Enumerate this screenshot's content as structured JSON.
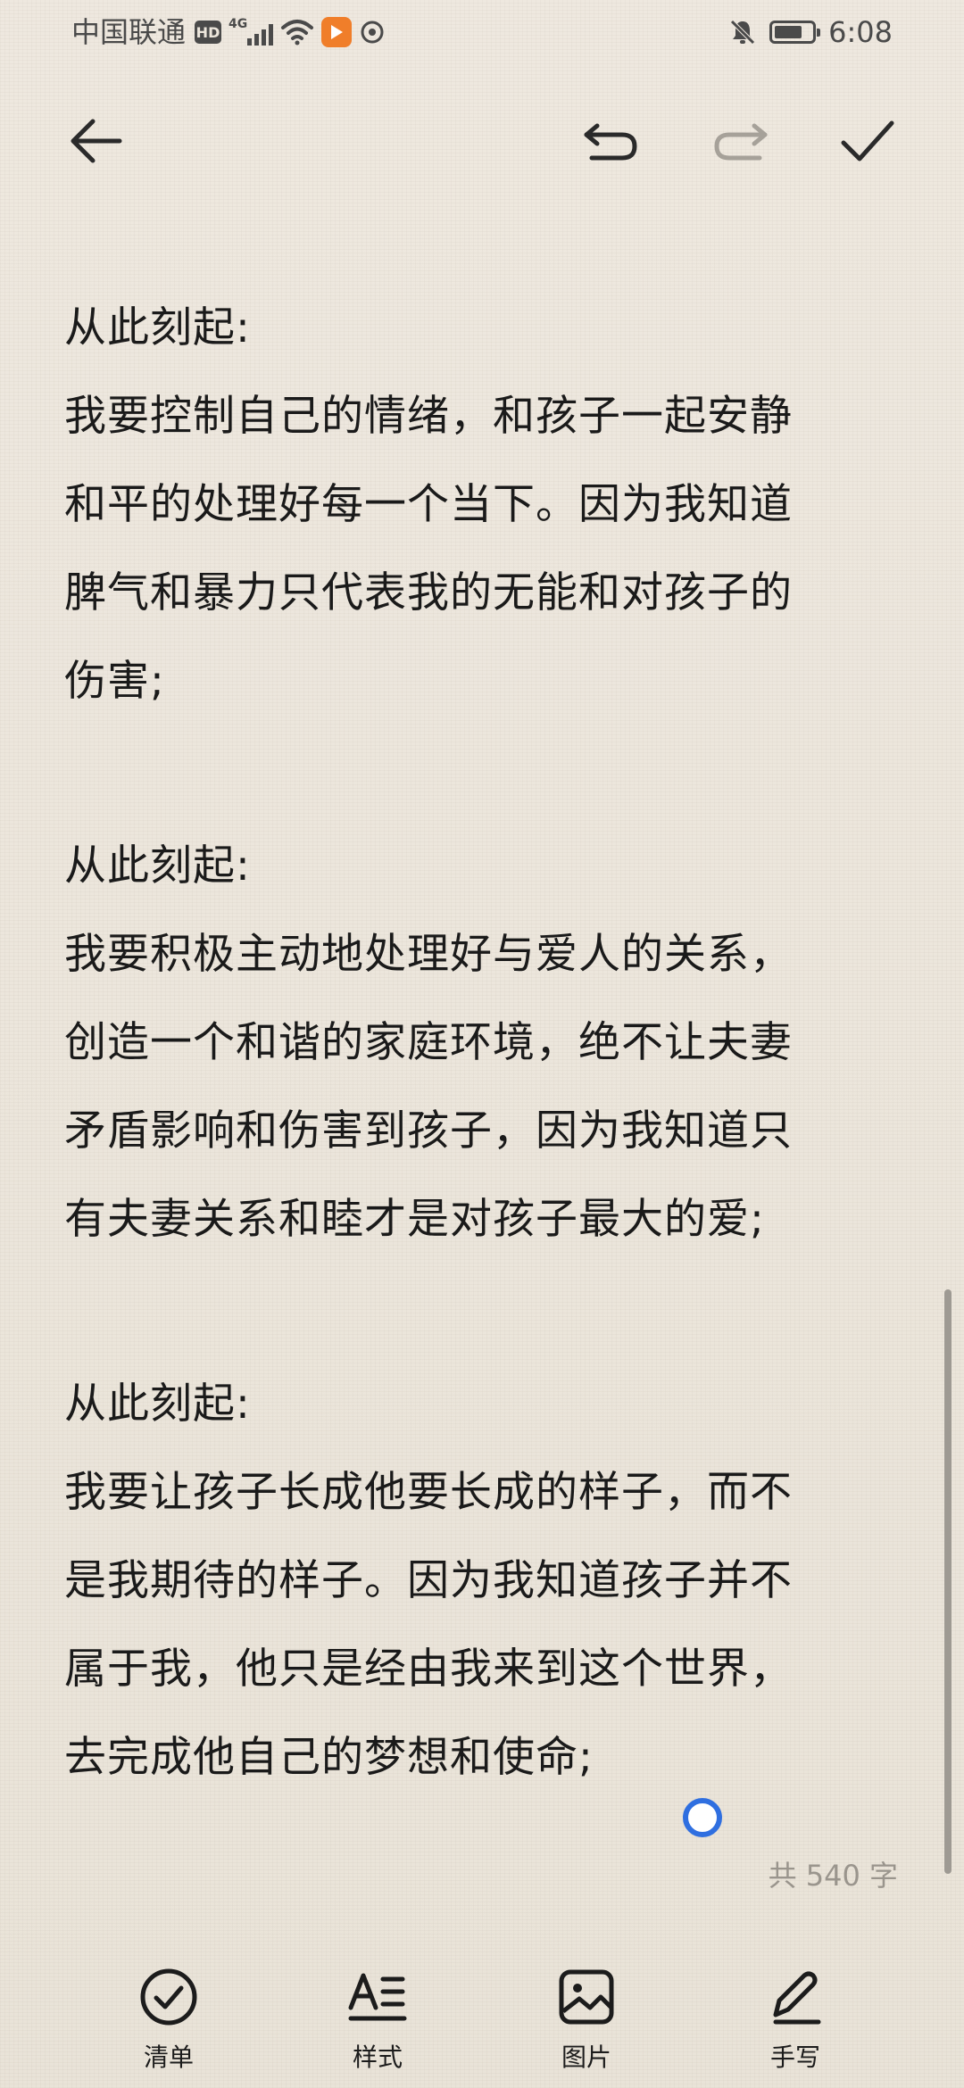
{
  "status_bar": {
    "carrier": "中国联通",
    "hd": "HD",
    "network": "4G",
    "time": "6:08",
    "battery_level": 0.75
  },
  "note": {
    "paragraphs": [
      {
        "heading": "从此刻起:",
        "lines": [
          "我要控制自己的情绪，和孩子一起安静",
          "和平的处理好每一个当下。因为我知道",
          "脾气和暴力只代表我的无能和对孩子的",
          "伤害;"
        ]
      },
      {
        "heading": "从此刻起:",
        "lines": [
          "我要积极主动地处理好与爱人的关系，",
          "创造一个和谐的家庭环境，绝不让夫妻",
          "矛盾影响和伤害到孩子，因为我知道只",
          "有夫妻关系和睦才是对孩子最大的爱;"
        ]
      },
      {
        "heading": "从此刻起:",
        "lines": [
          "我要让孩子长成他要长成的样子，而不",
          "是我期待的样子。因为我知道孩子并不",
          "属于我，他只是经由我来到这个世界，",
          "去完成他自己的梦想和使命;"
        ]
      }
    ],
    "word_count": "共 540 字"
  },
  "bottom_bar": {
    "checklist_label": "清单",
    "style_label": "样式",
    "image_label": "图片",
    "handwriting_label": "手写"
  },
  "colors": {
    "background": "#ece6dc",
    "text": "#1a1a1a",
    "cursor_handle": "#2f6fe0",
    "muted": "#9a958d",
    "app_badge": "#f07e2a"
  },
  "icons": {
    "toolbar": [
      "back-arrow-icon",
      "undo-icon",
      "redo-icon",
      "checkmark-icon"
    ],
    "bottom_bar": [
      "checklist-icon",
      "text-style-icon",
      "image-icon",
      "pen-icon"
    ]
  }
}
